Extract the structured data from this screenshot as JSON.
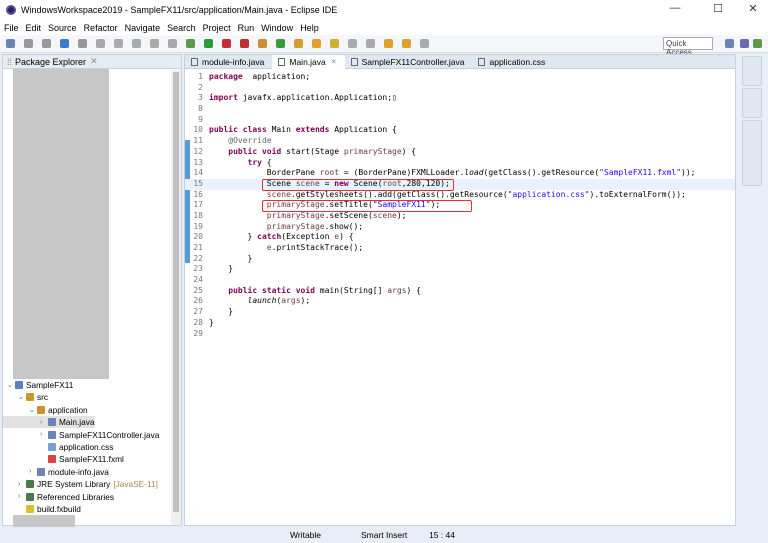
{
  "window": {
    "title": "WindowsWorkspace2019 - SampleFX11/src/application/Main.java - Eclipse IDE",
    "min": "—",
    "max": "☐",
    "close": "✕"
  },
  "menu": [
    "File",
    "Edit",
    "Source",
    "Refactor",
    "Navigate",
    "Search",
    "Project",
    "Run",
    "Window",
    "Help"
  ],
  "toolbar": {
    "quick_access": "Quick Access"
  },
  "explorer": {
    "title": "Package Explorer",
    "tree": [
      {
        "label": "SampleFX11",
        "depth": 0,
        "tw": "⌄",
        "color": "#5b7fbf"
      },
      {
        "label": "src",
        "depth": 1,
        "tw": "⌄",
        "color": "#c8962a"
      },
      {
        "label": "application",
        "depth": 2,
        "tw": "⌄",
        "color": "#c8962a"
      },
      {
        "label": "Main.java",
        "depth": 3,
        "tw": "›",
        "color": "#6a84b8",
        "selected": true
      },
      {
        "label": "SampleFX11Controller.java",
        "depth": 3,
        "tw": "›",
        "color": "#6a84b8"
      },
      {
        "label": "application.css",
        "depth": 3,
        "tw": "",
        "color": "#7aa0d0"
      },
      {
        "label": "SampleFX11.fxml",
        "depth": 3,
        "tw": "",
        "color": "#e04040"
      },
      {
        "label": "module-info.java",
        "depth": 2,
        "tw": "›",
        "color": "#6a84b8"
      },
      {
        "label": "JRE System Library",
        "suffix": "[JavaSE-11]",
        "depth": 1,
        "tw": "›",
        "color": "#4a7a4a"
      },
      {
        "label": "Referenced Libraries",
        "depth": 1,
        "tw": "›",
        "color": "#4a7a4a"
      },
      {
        "label": "build.fxbuild",
        "depth": 1,
        "tw": "",
        "color": "#d8c030"
      }
    ]
  },
  "editor": {
    "tabs": [
      {
        "label": "module-info.java",
        "active": false
      },
      {
        "label": "Main.java",
        "active": true,
        "close": "✕"
      },
      {
        "label": "SampleFX11Controller.java",
        "active": false
      },
      {
        "label": "application.css",
        "active": false
      }
    ],
    "lines": [
      {
        "n": "1",
        "s": [
          [
            "kw",
            "package"
          ],
          [
            "",
            "  application;"
          ]
        ]
      },
      {
        "n": "2",
        "s": []
      },
      {
        "n": "3",
        "s": [
          [
            "kw",
            "import"
          ],
          [
            "",
            " javafx.application.Application;▯"
          ]
        ]
      },
      {
        "n": "8",
        "s": []
      },
      {
        "n": "9",
        "s": []
      },
      {
        "n": "10",
        "s": [
          [
            "kw",
            "public class"
          ],
          [
            "",
            " Main "
          ],
          [
            "kw",
            "extends"
          ],
          [
            "",
            " Application {"
          ]
        ]
      },
      {
        "n": "11",
        "s": [
          [
            "",
            "    "
          ],
          [
            "ann",
            "@Override"
          ]
        ]
      },
      {
        "n": "12",
        "s": [
          [
            "",
            "    "
          ],
          [
            "kw",
            "public void"
          ],
          [
            "",
            " start(Stage "
          ],
          [
            "var",
            "primaryStage"
          ],
          [
            "",
            ") {"
          ]
        ]
      },
      {
        "n": "13",
        "s": [
          [
            "",
            "        "
          ],
          [
            "kw",
            "try"
          ],
          [
            "",
            " {"
          ]
        ]
      },
      {
        "n": "14",
        "s": [
          [
            "",
            "            BorderPane "
          ],
          [
            "var",
            "root"
          ],
          [
            "",
            " = (BorderPane)FXMLLoader."
          ],
          [
            "it",
            "load"
          ],
          [
            "",
            "(getClass().getResource("
          ],
          [
            "str",
            "\"SampleFX11.fxml\""
          ],
          [
            "",
            "));"
          ]
        ]
      },
      {
        "n": "15",
        "s": [
          [
            "",
            "            Scene "
          ],
          [
            "var",
            "scene"
          ],
          [
            "",
            " = "
          ],
          [
            "kw",
            "new"
          ],
          [
            "",
            " Scene("
          ],
          [
            "var",
            "root"
          ],
          [
            "",
            ",280,120);"
          ]
        ],
        "current": true
      },
      {
        "n": "16",
        "s": [
          [
            "",
            "            "
          ],
          [
            "var",
            "scene"
          ],
          [
            "",
            ".getStylesheets().add(getClass().getResource("
          ],
          [
            "str",
            "\"application.css\""
          ],
          [
            "",
            ").toExternalForm());"
          ]
        ]
      },
      {
        "n": "17",
        "s": [
          [
            "",
            "            "
          ],
          [
            "var",
            "primaryStage"
          ],
          [
            "",
            ".setTitle("
          ],
          [
            "str",
            "\"SampleFX11\""
          ],
          [
            "",
            ");"
          ]
        ]
      },
      {
        "n": "18",
        "s": [
          [
            "",
            "            "
          ],
          [
            "var",
            "primaryStage"
          ],
          [
            "",
            ".setScene("
          ],
          [
            "var",
            "scene"
          ],
          [
            "",
            ");"
          ]
        ]
      },
      {
        "n": "19",
        "s": [
          [
            "",
            "            "
          ],
          [
            "var",
            "primaryStage"
          ],
          [
            "",
            ".show();"
          ]
        ]
      },
      {
        "n": "20",
        "s": [
          [
            "",
            "        } "
          ],
          [
            "kw",
            "catch"
          ],
          [
            "",
            "(Exception "
          ],
          [
            "var",
            "e"
          ],
          [
            "",
            ") {"
          ]
        ]
      },
      {
        "n": "21",
        "s": [
          [
            "",
            "            "
          ],
          [
            "var",
            "e"
          ],
          [
            "",
            ".printStackTrace();"
          ]
        ]
      },
      {
        "n": "22",
        "s": [
          [
            "",
            "        }"
          ]
        ]
      },
      {
        "n": "23",
        "s": [
          [
            "",
            "    }"
          ]
        ]
      },
      {
        "n": "24",
        "s": []
      },
      {
        "n": "25",
        "s": [
          [
            "",
            "    "
          ],
          [
            "kw",
            "public static void"
          ],
          [
            "",
            " main(String[] "
          ],
          [
            "var",
            "args"
          ],
          [
            "",
            ") {"
          ]
        ]
      },
      {
        "n": "26",
        "s": [
          [
            "",
            "        "
          ],
          [
            "it",
            "launch"
          ],
          [
            "",
            "("
          ],
          [
            "var",
            "args"
          ],
          [
            "",
            ");"
          ]
        ]
      },
      {
        "n": "27",
        "s": [
          [
            "",
            "    }"
          ]
        ]
      },
      {
        "n": "28",
        "s": [
          [
            "",
            "}"
          ]
        ]
      },
      {
        "n": "29",
        "s": []
      }
    ]
  },
  "status": {
    "writable": "Writable",
    "insert": "Smart Insert",
    "position": "15 : 44"
  }
}
